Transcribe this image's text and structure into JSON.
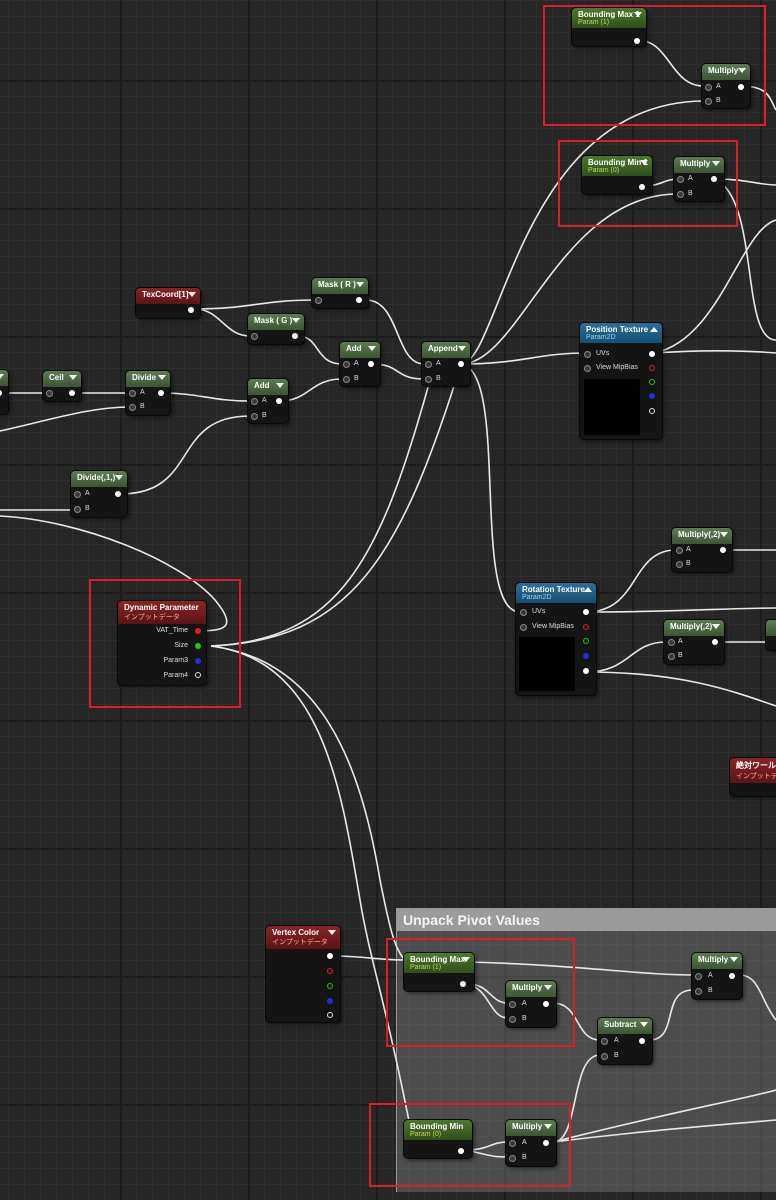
{
  "comment": {
    "title": "Unpack Pivot Values"
  },
  "nodes": {
    "bounding_max_1": {
      "title": "Bounding Max 1",
      "sub": "Param (1)"
    },
    "multiply_top": {
      "title": "Multiply",
      "a": "A",
      "b": "B"
    },
    "bounding_min_1": {
      "title": "Bounding Min 1",
      "sub": "Param (0)"
    },
    "multiply_2": {
      "title": "Multiply",
      "a": "A",
      "b": "B"
    },
    "texcoord": {
      "title": "TexCoord[1]"
    },
    "mask_r": {
      "title": "Mask ( R )"
    },
    "mask_g": {
      "title": "Mask ( G )"
    },
    "add_top": {
      "title": "Add",
      "a": "A",
      "b": "B"
    },
    "append": {
      "title": "Append",
      "a": "A",
      "b": "B"
    },
    "ceil": {
      "title": "Ceil"
    },
    "divide": {
      "title": "Divide",
      "a": "A",
      "b": "B"
    },
    "add_mid": {
      "title": "Add",
      "a": "A",
      "b": "B"
    },
    "divide_1": {
      "title": "Divide(,1,)",
      "a": "A",
      "b": "B"
    },
    "position_texture": {
      "title": "Position Texture",
      "sub": "Param2D",
      "uvs": "UVs",
      "mip": "View MipBias"
    },
    "multiply_r1": {
      "title": "Multiply(,2)",
      "a": "A",
      "b": "B"
    },
    "rotation_texture": {
      "title": "Rotation Texture",
      "sub": "Param2D",
      "uvs": "UVs",
      "mip": "View MipBias"
    },
    "multiply_r2": {
      "title": "Multiply(,2)",
      "a": "A",
      "b": "B"
    },
    "dynamic_parameter": {
      "title": "Dynamic Parameter",
      "sub": "インプットデータ",
      "p1": "VAT_Time",
      "p2": "Size",
      "p3": "Param3",
      "p4": "Param4"
    },
    "abs_world": {
      "title": "絶対ワール",
      "sub": "インプットデ"
    },
    "vertex_color": {
      "title": "Vertex Color",
      "sub": "インプットデータ"
    },
    "bounding_max": {
      "title": "Bounding Max",
      "sub": "Param (1)"
    },
    "multiply_c1": {
      "title": "Multiply",
      "a": "A",
      "b": "B"
    },
    "subtract": {
      "title": "Subtract",
      "a": "A",
      "b": "B"
    },
    "multiply_c2": {
      "title": "Multiply",
      "a": "A",
      "b": "B"
    },
    "bounding_min": {
      "title": "Bounding Min",
      "sub": "Param (0)"
    },
    "multiply_c3": {
      "title": "Multiply",
      "a": "A",
      "b": "B"
    }
  }
}
